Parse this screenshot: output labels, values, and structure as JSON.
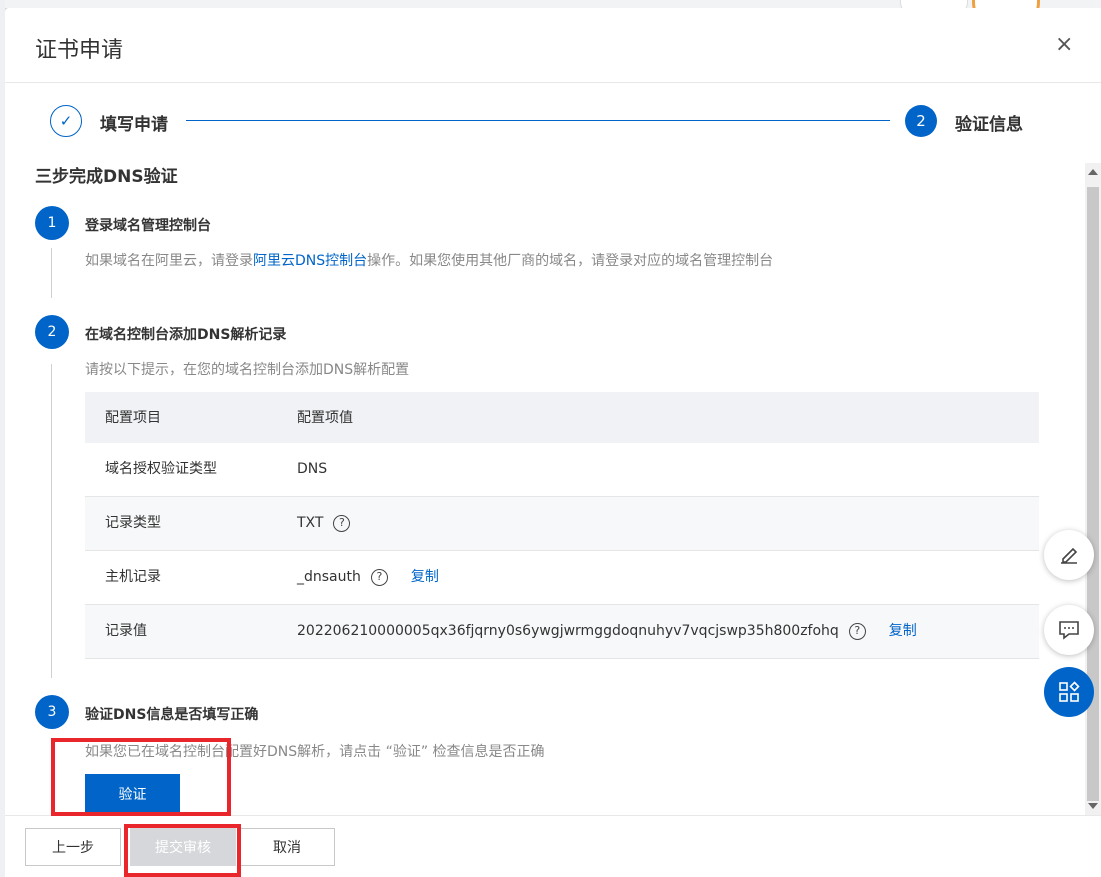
{
  "modal": {
    "title": "证书申请",
    "close_icon": "×"
  },
  "steps": {
    "step1": {
      "label": "填写申请",
      "icon": "✓"
    },
    "step2": {
      "number": "2",
      "label": "验证信息"
    }
  },
  "dns": {
    "section_title": "三步完成DNS验证",
    "step1": {
      "number": "1",
      "title": "登录域名管理控制台",
      "desc_before": "如果域名在阿里云，请登录",
      "desc_link": "阿里云DNS控制台",
      "desc_after": "操作。如果您使用其他厂商的域名，请登录对应的域名管理控制台"
    },
    "step2": {
      "number": "2",
      "title": "在域名控制台添加DNS解析记录",
      "desc": "请按以下提示，在您的域名控制台添加DNS解析配置"
    },
    "step3": {
      "number": "3",
      "title": "验证DNS信息是否填写正确",
      "desc": "如果您已在域名控制台配置好DNS解析，请点击 “验证” 检查信息是否正确",
      "verify_label": "验证"
    }
  },
  "table": {
    "headers": [
      "配置项目",
      "配置项值"
    ],
    "rows": [
      {
        "name": "域名授权验证类型",
        "value": "DNS"
      },
      {
        "name": "记录类型",
        "value": "TXT"
      },
      {
        "name": "主机记录",
        "value": "_dnsauth",
        "copy": "复制"
      },
      {
        "name": "记录值",
        "value": "202206210000005qx36fjqrny0s6ywgjwrmggdoqnuhyv7vqcjswp35h800zfohq",
        "copy": "复制"
      }
    ],
    "help_icon": "?"
  },
  "footer": {
    "prev_label": "上一步",
    "submit_label": "提交审核",
    "cancel_label": "取消"
  },
  "side_buttons": [
    "edit-icon",
    "chat-icon",
    "apps-icon"
  ],
  "colors": {
    "accent": "#0064c8",
    "highlight": "#e8262b",
    "disabled": "#d5d7da"
  }
}
